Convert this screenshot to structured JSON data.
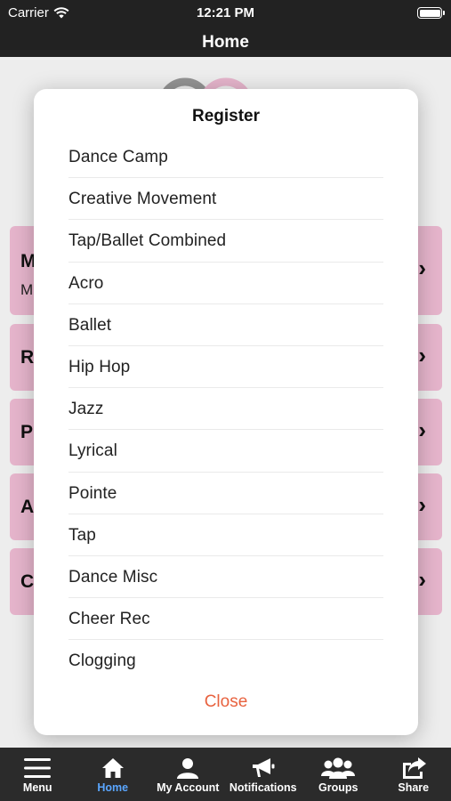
{
  "status_bar": {
    "carrier": "Carrier",
    "time": "12:21 PM"
  },
  "nav": {
    "title": "Home"
  },
  "background_tiles": [
    {
      "letter": "M",
      "sub": "M"
    },
    {
      "letter": "R",
      "sub": ""
    },
    {
      "letter": "P",
      "sub": ""
    },
    {
      "letter": "A",
      "sub": ""
    },
    {
      "letter": "C",
      "sub": ""
    }
  ],
  "modal": {
    "title": "Register",
    "items": [
      "Dance Camp",
      "Creative Movement",
      "Tap/Ballet Combined",
      "Acro",
      "Ballet",
      "Hip Hop",
      "Jazz",
      "Lyrical",
      "Pointe",
      "Tap",
      "Dance Misc",
      "Cheer Rec",
      "Clogging"
    ],
    "close_label": "Close"
  },
  "tabbar": {
    "tabs": [
      {
        "label": "Menu",
        "icon": "menu-icon"
      },
      {
        "label": "Home",
        "icon": "home-icon"
      },
      {
        "label": "My Account",
        "icon": "person-icon"
      },
      {
        "label": "Notifications",
        "icon": "megaphone-icon"
      },
      {
        "label": "Groups",
        "icon": "groups-icon"
      },
      {
        "label": "Share",
        "icon": "share-icon"
      }
    ],
    "active_index": 1
  },
  "colors": {
    "accent_close": "#e8623f",
    "tile_pink": "#efbcd4",
    "tab_active": "#5aa6ff",
    "bar_dark": "#222222"
  }
}
